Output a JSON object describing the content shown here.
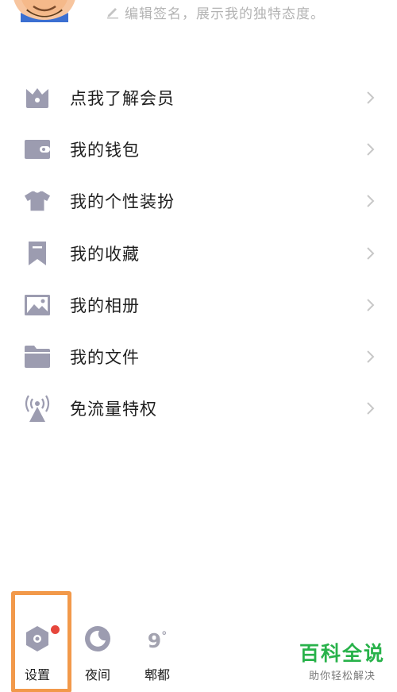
{
  "profile": {
    "signature_placeholder": "编辑签名，展示我的独特态度。"
  },
  "menu": {
    "items": [
      {
        "label": "点我了解会员",
        "icon": "crown-icon"
      },
      {
        "label": "我的钱包",
        "icon": "wallet-icon"
      },
      {
        "label": "我的个性装扮",
        "icon": "shirt-icon"
      },
      {
        "label": "我的收藏",
        "icon": "bookmark-icon"
      },
      {
        "label": "我的相册",
        "icon": "photo-icon"
      },
      {
        "label": "我的文件",
        "icon": "folder-icon"
      },
      {
        "label": "免流量特权",
        "icon": "signal-tower-icon"
      }
    ]
  },
  "bottom_bar": {
    "settings_label": "设置",
    "night_label": "夜间",
    "weather_temp": "9",
    "weather_unit": "°",
    "weather_city": "郫都"
  },
  "watermark": {
    "title": "百科全说",
    "subtitle": "助你轻松解决"
  },
  "colors": {
    "icon_gray": "#9c9cb0",
    "highlight": "#f2994a",
    "badge": "#e6463c",
    "watermark_green": "#28b24a"
  }
}
